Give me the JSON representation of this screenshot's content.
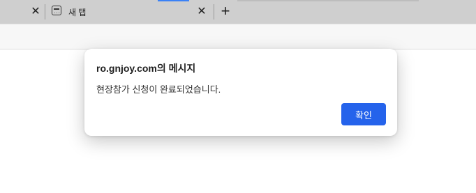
{
  "tabstrip": {
    "prev_tab_close_glyph": "✕",
    "active_tab": {
      "title": "새 탭",
      "favicon": "new-tab-page-icon",
      "close_glyph": "✕"
    },
    "new_tab_glyph": "+",
    "accent_color": "#3b82f6"
  },
  "dialog": {
    "title": "ro.gnjoy.com의 메시지",
    "message": "현장참가 신청이 완료되었습니다.",
    "ok_label": "확인",
    "ok_color": "#2563eb"
  }
}
